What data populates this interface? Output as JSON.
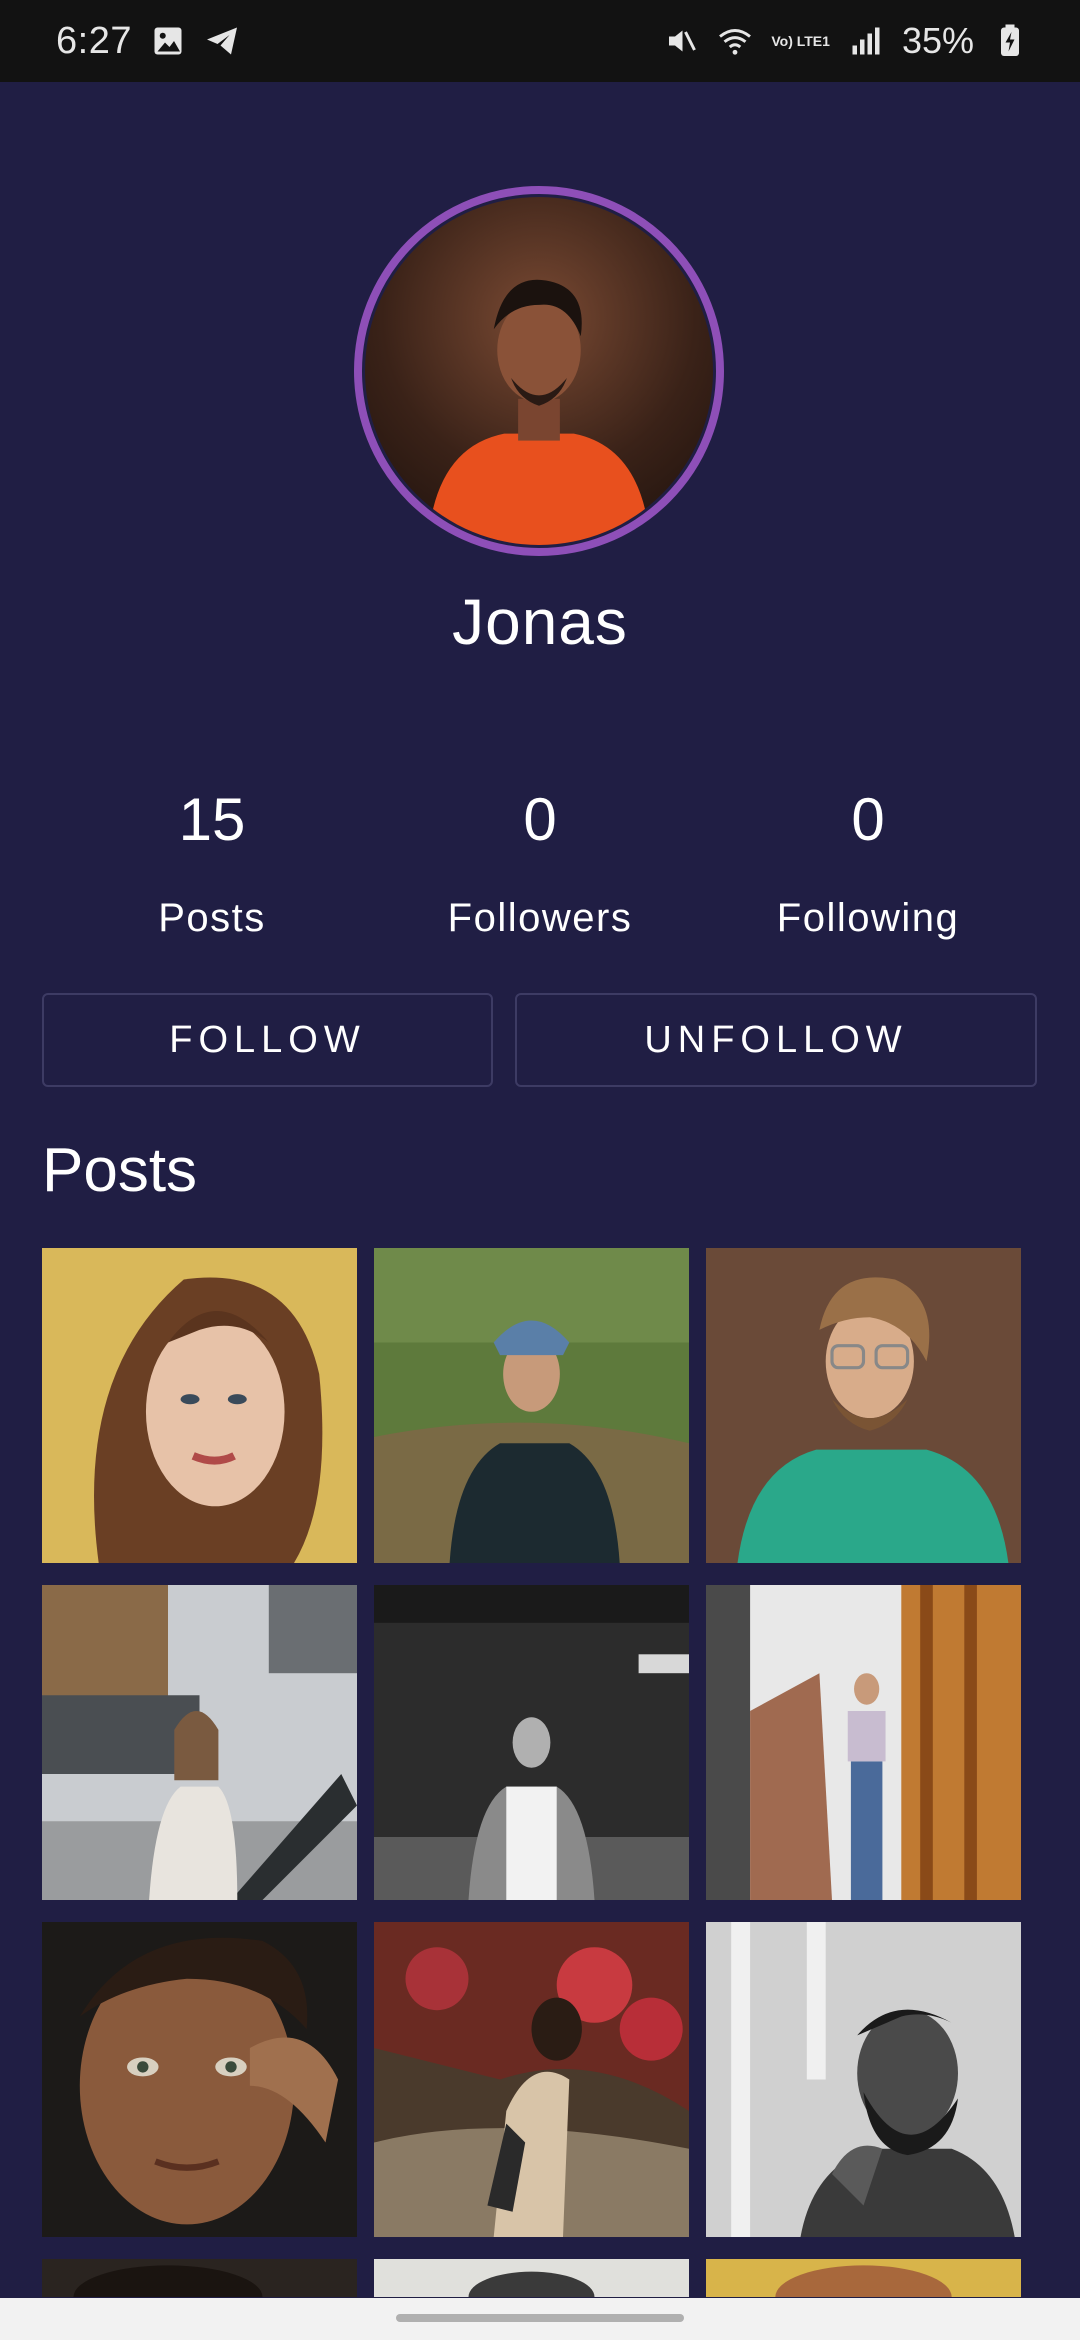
{
  "status_bar": {
    "time": "6:27",
    "battery": "35%",
    "lte_label": "Vo) LTE1"
  },
  "profile": {
    "username": "Jonas",
    "ring_color": "#8e4fb8"
  },
  "stats": [
    {
      "value": "15",
      "label": "Posts"
    },
    {
      "value": "0",
      "label": "Followers"
    },
    {
      "value": "0",
      "label": "Following"
    }
  ],
  "buttons": {
    "follow": "FOLLOW",
    "unfollow": "UNFOLLOW"
  },
  "posts_section": {
    "title": "Posts"
  },
  "colors": {
    "background": "#201e44",
    "button_border": "#3d3b64"
  }
}
